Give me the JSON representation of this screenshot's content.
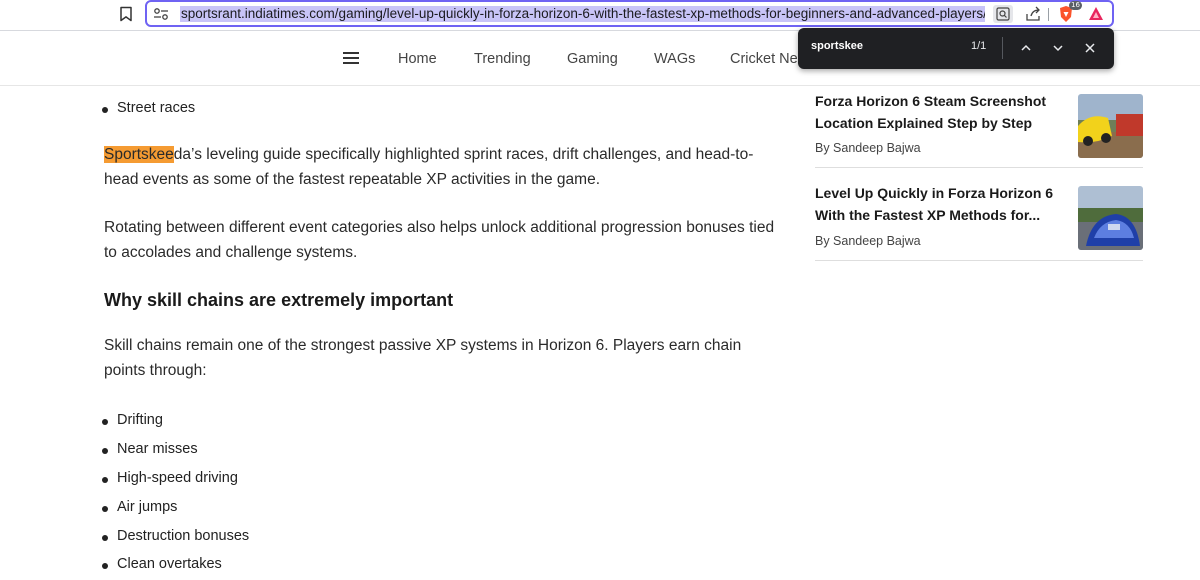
{
  "browser": {
    "url": "sportsrant.indiatimes.com/gaming/level-up-quickly-in-forza-horizon-6-with-the-fastest-xp-methods-for-beginners-and-advanced-players/articles",
    "shield_count": "16"
  },
  "find_bar": {
    "query": "sportskee",
    "match_count": "1/1"
  },
  "nav": {
    "items": [
      "Home",
      "Trending",
      "Gaming",
      "WAGs",
      "Cricket Ne"
    ]
  },
  "article": {
    "top_bullet": "Street races",
    "para1": {
      "highlight": "Sportskee",
      "rest": "da’s leveling guide specifically highlighted sprint races, drift challenges, and head-to-head events as some of the fastest repeatable XP activities in the game."
    },
    "para2": "Rotating between different event categories also helps unlock additional progression bonuses tied to accolades and challenge systems.",
    "heading": "Why skill chains are extremely important",
    "para3": "Skill chains remain one of the strongest passive XP systems in Horizon 6. Players earn chain points through:",
    "list": [
      "Drifting",
      "Near misses",
      "High-speed driving",
      "Air jumps",
      "Destruction bonuses",
      "Clean overtakes"
    ]
  },
  "sidebar": {
    "cards": [
      {
        "title": "Forza Horizon 6 Steam Screenshot Location Explained Step by Step",
        "author": "By Sandeep Bajwa"
      },
      {
        "title": "Level Up Quickly in Forza Horizon 6 With the Fastest XP Methods for...",
        "author": "By Sandeep Bajwa"
      }
    ]
  },
  "colors": {
    "url_border": "#6f63f3",
    "url_selection": "#c8c4f7",
    "find_highlight": "#f59b32",
    "findbar_bg": "#1f2023"
  }
}
